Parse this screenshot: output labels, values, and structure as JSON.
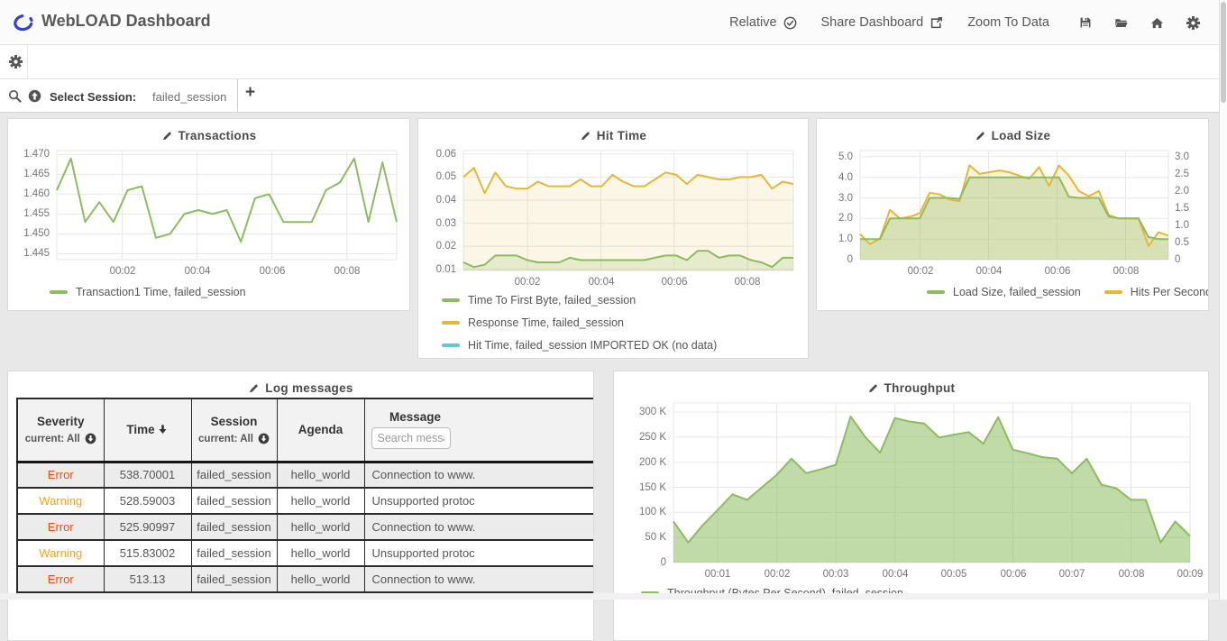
{
  "app": {
    "header": {
      "title": "WebLOAD Dashboard",
      "logo_icon": "webload-logo-icon",
      "menu": [
        {
          "label": "Relative",
          "icon": "check-circle-icon"
        },
        {
          "label": "Share Dashboard",
          "icon": "share-icon"
        },
        {
          "label": "Zoom To Data",
          "icon": ""
        }
      ],
      "icon_buttons": [
        "save-icon",
        "folder-open-icon",
        "home-icon",
        "gear-icon"
      ]
    },
    "toolbar": {
      "icons": [
        "gear-icon"
      ]
    },
    "session_bar": {
      "icons": [
        "search-icon",
        "arrow-circle-up-icon"
      ],
      "label": "Select Session:",
      "value": "failed_session",
      "add_tab": "+"
    },
    "colors": {
      "accent_green": "#2fb52f",
      "green_series": "#8cbb61",
      "yellow_series": "#e0b534",
      "cyan_series": "#5ec7d8",
      "error": "#e84e1d",
      "warning": "#f0a519"
    }
  },
  "chart_data": [
    {
      "id": "chart-transactions",
      "type": "line",
      "title": "Transactions",
      "x_range_seconds": [
        15,
        560
      ],
      "xticks": [
        {
          "v": 120,
          "label": "00:02"
        },
        {
          "v": 240,
          "label": "00:04"
        },
        {
          "v": 360,
          "label": "00:06"
        },
        {
          "v": 480,
          "label": "00:08"
        }
      ],
      "ylim": [
        1.4435,
        1.471
      ],
      "yticks": [
        {
          "v": 1.445,
          "label": "1.445"
        },
        {
          "v": 1.45,
          "label": "1.450"
        },
        {
          "v": 1.455,
          "label": "1.455"
        },
        {
          "v": 1.46,
          "label": "1.460"
        },
        {
          "v": 1.465,
          "label": "1.465"
        },
        {
          "v": 1.47,
          "label": "1.470"
        }
      ],
      "legend_position": "bottom",
      "series": [
        {
          "name": "Transaction1 Time, failed_session",
          "color": "#8cbb61",
          "values": [
            1.461,
            1.469,
            1.453,
            1.458,
            1.453,
            1.461,
            1.462,
            1.449,
            1.45,
            1.455,
            1.456,
            1.455,
            1.456,
            1.448,
            1.459,
            1.46,
            1.453,
            1.453,
            1.453,
            1.461,
            1.463,
            1.469,
            1.453,
            1.468,
            1.453
          ]
        }
      ]
    },
    {
      "id": "chart-hittime",
      "type": "line",
      "title": "Hit Time",
      "x_range_seconds": [
        15,
        555
      ],
      "xticks": [
        {
          "v": 120,
          "label": "00:02"
        },
        {
          "v": 240,
          "label": "00:04"
        },
        {
          "v": 360,
          "label": "00:06"
        },
        {
          "v": 480,
          "label": "00:08"
        }
      ],
      "ylim": [
        0.0095,
        0.0615
      ],
      "yticks": [
        {
          "v": 0.01,
          "label": "0.01"
        },
        {
          "v": 0.02,
          "label": "0.02"
        },
        {
          "v": 0.03,
          "label": "0.03"
        },
        {
          "v": 0.04,
          "label": "0.04"
        },
        {
          "v": 0.05,
          "label": "0.05"
        },
        {
          "v": 0.06,
          "label": "0.06"
        }
      ],
      "legend_position": "bottom",
      "series": [
        {
          "name": "Time To First Byte, failed_session",
          "color": "#8cbb61",
          "values": [
            0.013,
            0.011,
            0.012,
            0.016,
            0.016,
            0.016,
            0.014,
            0.013,
            0.013,
            0.013,
            0.015,
            0.014,
            0.014,
            0.014,
            0.014,
            0.014,
            0.014,
            0.014,
            0.015,
            0.016,
            0.016,
            0.014,
            0.018,
            0.018,
            0.015,
            0.016,
            0.016,
            0.014,
            0.013,
            0.011,
            0.015,
            0.015
          ]
        },
        {
          "name": "Response Time, failed_session",
          "color": "#e3b838",
          "values": [
            0.05,
            0.054,
            0.043,
            0.052,
            0.046,
            0.045,
            0.045,
            0.048,
            0.046,
            0.046,
            0.046,
            0.049,
            0.046,
            0.046,
            0.051,
            0.048,
            0.046,
            0.046,
            0.049,
            0.052,
            0.051,
            0.047,
            0.051,
            0.05,
            0.049,
            0.049,
            0.05,
            0.05,
            0.051,
            0.045,
            0.048,
            0.047
          ]
        },
        {
          "name": "Hit Time, failed_session IMPORTED OK (no data)",
          "color": "#5ec7d8",
          "values": []
        }
      ]
    },
    {
      "id": "chart-loadsize",
      "type": "line",
      "title": "Load Size",
      "x_range_seconds": [
        15,
        555
      ],
      "xticks": [
        {
          "v": 120,
          "label": "00:02"
        },
        {
          "v": 240,
          "label": "00:04"
        },
        {
          "v": 360,
          "label": "00:06"
        },
        {
          "v": 480,
          "label": "00:08"
        }
      ],
      "ylim": [
        0,
        5.3
      ],
      "yticks": [
        {
          "v": 0,
          "label": "0"
        },
        {
          "v": 1,
          "label": "1.0"
        },
        {
          "v": 2,
          "label": "2.0"
        },
        {
          "v": 3,
          "label": "3.0"
        },
        {
          "v": 4,
          "label": "4.0"
        },
        {
          "v": 5,
          "label": "5.0"
        }
      ],
      "y2lim": [
        0,
        3.18
      ],
      "y2ticks": [
        {
          "v": 0,
          "label": "0"
        },
        {
          "v": 0.5,
          "label": "0.5"
        },
        {
          "v": 1,
          "label": "1.0"
        },
        {
          "v": 1.5,
          "label": "1.5"
        },
        {
          "v": 2,
          "label": "2.0"
        },
        {
          "v": 2.5,
          "label": "2.5"
        },
        {
          "v": 3,
          "label": "3.0"
        }
      ],
      "legend_position": "bottom",
      "series": [
        {
          "name": "Load Size, failed_session",
          "color": "#8cbb61",
          "axis": "y",
          "values": [
            1,
            1,
            1,
            2,
            2,
            2,
            2,
            3,
            3,
            3,
            2.95,
            4,
            4,
            4,
            4,
            4,
            4,
            4,
            4,
            4,
            4,
            3.05,
            3,
            3,
            3,
            2.1,
            2,
            2,
            2,
            1.1,
            1,
            1
          ]
        },
        {
          "name": "Hits Per Second, failed_session",
          "color": "#e3b838",
          "axis": "y2",
          "values": [
            0.75,
            0.45,
            0.62,
            1.45,
            1.2,
            1.25,
            1.35,
            1.95,
            1.9,
            1.75,
            1.7,
            2.75,
            2.5,
            2.55,
            2.6,
            2.55,
            2.45,
            2.35,
            2.7,
            2.15,
            2.75,
            2.45,
            2.0,
            1.85,
            2.0,
            1.3,
            1.2,
            1.2,
            1.2,
            0.4,
            0.8,
            0.7
          ]
        }
      ]
    },
    {
      "id": "chart-throughput",
      "type": "area",
      "title": "Throughput",
      "x_range_seconds": [
        15,
        540
      ],
      "xticks": [
        {
          "v": 60,
          "label": "00:01"
        },
        {
          "v": 120,
          "label": "00:02"
        },
        {
          "v": 180,
          "label": "00:03"
        },
        {
          "v": 240,
          "label": "00:04"
        },
        {
          "v": 300,
          "label": "00:05"
        },
        {
          "v": 360,
          "label": "00:06"
        },
        {
          "v": 420,
          "label": "00:07"
        },
        {
          "v": 480,
          "label": "00:08"
        },
        {
          "v": 540,
          "label": "00:09"
        }
      ],
      "ylim": [
        0,
        318000
      ],
      "yticks": [
        {
          "v": 0,
          "label": "0"
        },
        {
          "v": 50000,
          "label": "50 K"
        },
        {
          "v": 100000,
          "label": "100 K"
        },
        {
          "v": 150000,
          "label": "150 K"
        },
        {
          "v": 200000,
          "label": "200 K"
        },
        {
          "v": 250000,
          "label": "250 K"
        },
        {
          "v": 300000,
          "label": "300 K"
        }
      ],
      "legend_position": "bottom",
      "series": [
        {
          "name": "Throughput (Bytes Per Second), failed_session",
          "color": "#8cbb61",
          "values": [
            82000,
            40000,
            75000,
            105000,
            136000,
            125000,
            150000,
            175000,
            207000,
            178000,
            186000,
            195000,
            291000,
            250000,
            219000,
            288000,
            281000,
            277000,
            249000,
            255000,
            260000,
            237000,
            290000,
            225000,
            218000,
            210000,
            207000,
            178000,
            207000,
            155000,
            148000,
            125000,
            125000,
            40000,
            82000,
            53000
          ]
        }
      ]
    }
  ],
  "log_table": {
    "title": "Log messages",
    "columns": [
      {
        "label": "Severity",
        "sub": "current: All",
        "filter_icon": "arrow-circle-down-icon"
      },
      {
        "label": "Time",
        "sort_icon": "sort-down-icon"
      },
      {
        "label": "Session",
        "sub": "current: All",
        "filter_icon": "arrow-circle-down-icon"
      },
      {
        "label": "Agenda"
      },
      {
        "label": "Message",
        "search_placeholder": "Search message"
      }
    ],
    "severity_colors": {
      "Error": "#e84e1d",
      "Warning": "#f0a519"
    },
    "rows": [
      {
        "severity": "Error",
        "time": "538.70001",
        "session": "failed_session",
        "agenda": "hello_world",
        "message": "Connection to www."
      },
      {
        "severity": "Warning",
        "time": "528.59003",
        "session": "failed_session",
        "agenda": "hello_world",
        "message": "Unsupported protoc"
      },
      {
        "severity": "Error",
        "time": "525.90997",
        "session": "failed_session",
        "agenda": "hello_world",
        "message": "Connection to www."
      },
      {
        "severity": "Warning",
        "time": "515.83002",
        "session": "failed_session",
        "agenda": "hello_world",
        "message": "Unsupported protoc"
      },
      {
        "severity": "Error",
        "time": "513.13",
        "session": "failed_session",
        "agenda": "hello_world",
        "message": "Connection to www."
      }
    ]
  }
}
